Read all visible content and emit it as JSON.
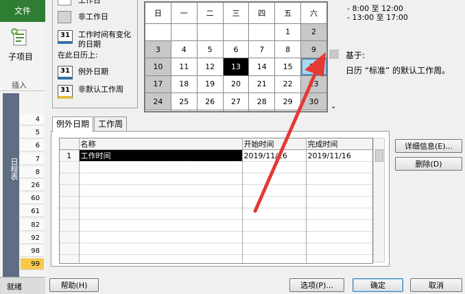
{
  "ribbon": {
    "file_tab": "文件",
    "subproject_label": "子项目",
    "insert_group": "插入"
  },
  "timeline": {
    "label": "日程表"
  },
  "row_numbers": [
    "4",
    "5",
    "6",
    "7",
    "8",
    "26",
    "60",
    "61",
    "82",
    "92",
    "98",
    "99"
  ],
  "selected_row_number": "99",
  "status": {
    "ready": "就绪"
  },
  "legend": {
    "working": "工作日",
    "nonworking": "非工作日",
    "edited_hours": "工作时间有变化的日期",
    "on_this_calendar": "在此日历上:",
    "exception_days": "例外日期",
    "nondefault_week": "非默认工作周",
    "icon_number": "31"
  },
  "calendar": {
    "weekdays": [
      "日",
      "一",
      "二",
      "三",
      "四",
      "五",
      "六"
    ],
    "rows": [
      [
        "",
        "",
        "",
        "",
        "",
        "1",
        "2"
      ],
      [
        "3",
        "4",
        "5",
        "6",
        "7",
        "8",
        "9"
      ],
      [
        "10",
        "11",
        "12",
        "13",
        "14",
        "15",
        "16"
      ],
      [
        "17",
        "18",
        "19",
        "20",
        "21",
        "22",
        "23"
      ],
      [
        "24",
        "25",
        "26",
        "27",
        "28",
        "29",
        "30"
      ],
      [
        "",
        "",
        "",
        "",
        "",
        "",
        ""
      ]
    ],
    "today": "13",
    "selected": "16",
    "scroll_icon": "chevron-down-icon"
  },
  "work_times": {
    "line1": "- 8:00 至 12:00",
    "line2": "- 13:00 至 17:00"
  },
  "based_on": {
    "label": "基于:",
    "description": "日历 “标准” 的默认工作周。"
  },
  "tabs": [
    {
      "label": "例外日期",
      "active": true
    },
    {
      "label": "工作周",
      "active": false
    }
  ],
  "grid": {
    "headers": [
      "",
      "名称",
      "开始时间",
      "完成时间"
    ],
    "rows": [
      [
        "1",
        "工作时间",
        "2019/11/16",
        "2019/11/16"
      ]
    ],
    "empty_rows": 10
  },
  "buttons": {
    "details": "详细信息(E)...",
    "delete": "删除(D)",
    "help": "帮助(H)",
    "options": "选项(P)...",
    "ok": "确定",
    "cancel": "取消"
  },
  "colors": {
    "file_tab": "#2e7d32",
    "selected_row": "#f7c94b",
    "nonworking_day": "#c8c8c8",
    "selected_day": "#a9d8f2",
    "arrow": "#e53935"
  }
}
